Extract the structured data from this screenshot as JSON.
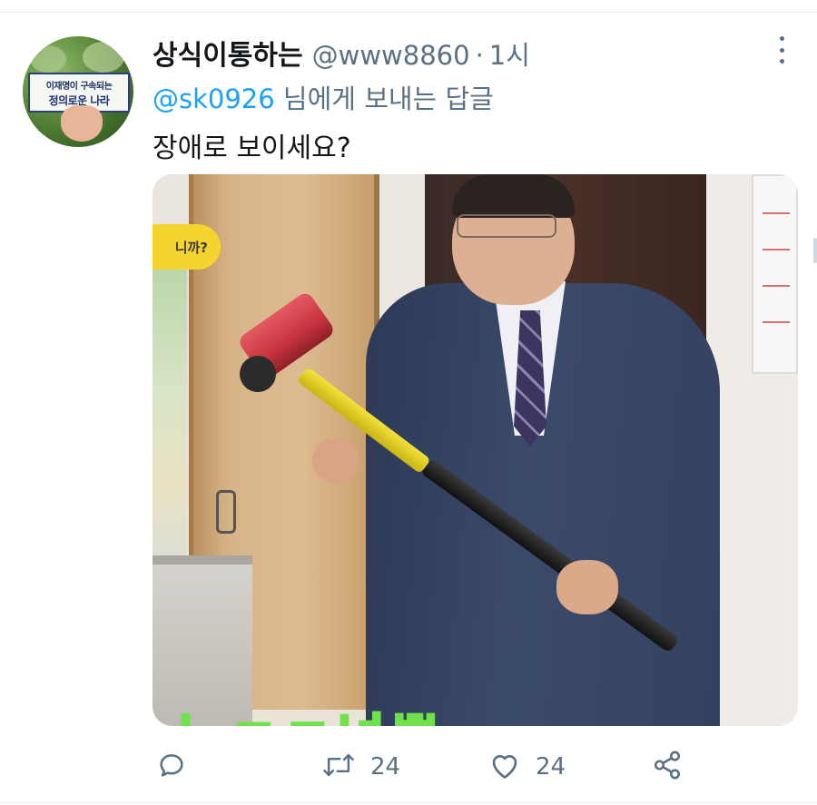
{
  "avatar": {
    "sign_line1": "이재명이 구속되는",
    "sign_line2": "정의로운 나라"
  },
  "header": {
    "display_name": "상식이통하는",
    "handle": "@www8860",
    "separator": "·",
    "time": "1시"
  },
  "reply": {
    "to_handle": "@sk0926",
    "rest": " 님에게 보내는 답글"
  },
  "tweet": {
    "text": "장애로 보이세요?"
  },
  "media": {
    "bubble_text": "니까?",
    "caption_text": "뉴ㅈㅋ넘뿌"
  },
  "actions": {
    "reply_icon": "comment-icon",
    "retweet_icon": "retweet-icon",
    "retweet_count": "24",
    "like_icon": "heart-icon",
    "like_count": "24",
    "share_icon": "share-icon"
  },
  "colors": {
    "link": "#1da1f2",
    "secondary_text": "#5b7083",
    "primary_text": "#14171a"
  }
}
